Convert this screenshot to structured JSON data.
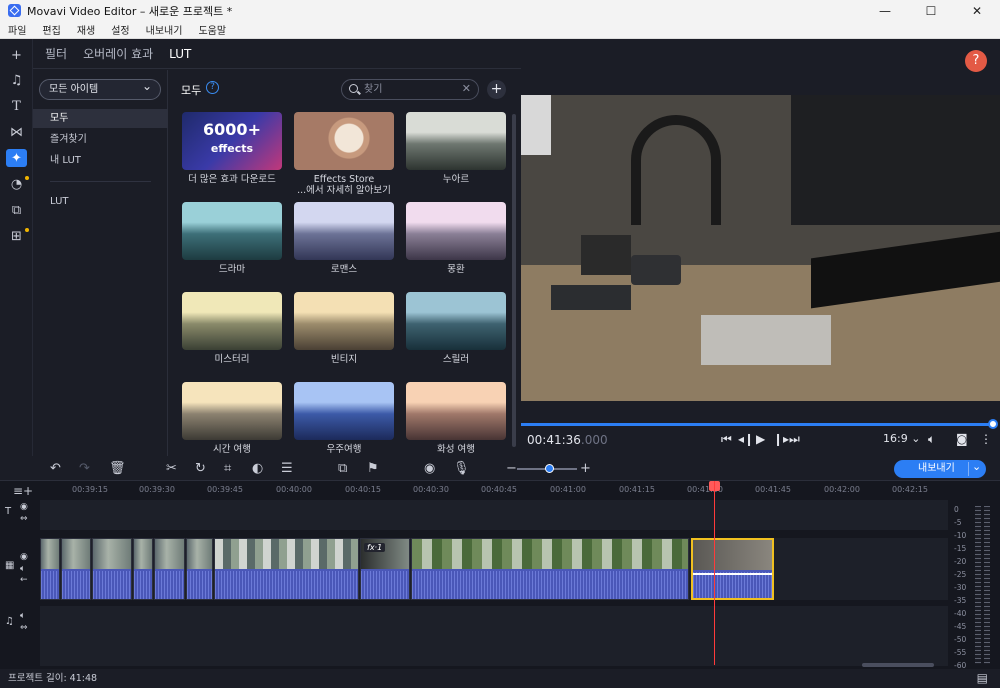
{
  "window": {
    "title": "Movavi Video Editor – 새로운 프로젝트 *"
  },
  "menu": [
    "파일",
    "편집",
    "재생",
    "설정",
    "내보내기",
    "도움말"
  ],
  "panel": {
    "tabs": [
      "필터",
      "오버레이 효과",
      "LUT"
    ],
    "active_tab": "LUT",
    "category_dropdown": "모든 아이템",
    "categories": [
      "모두",
      "즐겨찾기",
      "내 LUT",
      "LUT"
    ],
    "grid_title": "모두",
    "search_placeholder": "찾기",
    "tiles": [
      {
        "label": "더 많은 효과 다운로드",
        "badge_big": "6000+",
        "badge_small": "effects"
      },
      {
        "label": "Effects Store",
        "label2": "...에서 자세히 알아보기"
      },
      {
        "label": "누아르"
      },
      {
        "label": "드라마"
      },
      {
        "label": "로맨스"
      },
      {
        "label": "몽환"
      },
      {
        "label": "미스터리"
      },
      {
        "label": "빈티지"
      },
      {
        "label": "스릴러"
      },
      {
        "label": "시간 여행"
      },
      {
        "label": "우주여행"
      },
      {
        "label": "화성 여행"
      }
    ]
  },
  "preview": {
    "timecode_main": "00:41:36",
    "timecode_ms": ".000",
    "aspect": "16:9 ⌄",
    "progress": 1.0
  },
  "timeline": {
    "export_label": "내보내기",
    "ruler": [
      "00:39:15",
      "00:39:30",
      "00:39:45",
      "00:40:00",
      "00:40:15",
      "00:40:30",
      "00:40:45",
      "00:41:00",
      "00:41:15",
      "00:41:30",
      "00:41:45",
      "00:42:00",
      "00:42:15"
    ],
    "fx_badge": "fx·1",
    "meter_labels": [
      "0",
      "-5",
      "-10",
      "-15",
      "-20",
      "-25",
      "-30",
      "-35",
      "-40",
      "-45",
      "-50",
      "-55",
      "-60"
    ]
  },
  "status": {
    "project_length": "프로젝트 길이: 41:48"
  },
  "colors": {
    "accent": "#2c7ef4",
    "playhead": "#ff3b3b",
    "selected_clip": "#f0c020",
    "help": "#e35a45"
  }
}
